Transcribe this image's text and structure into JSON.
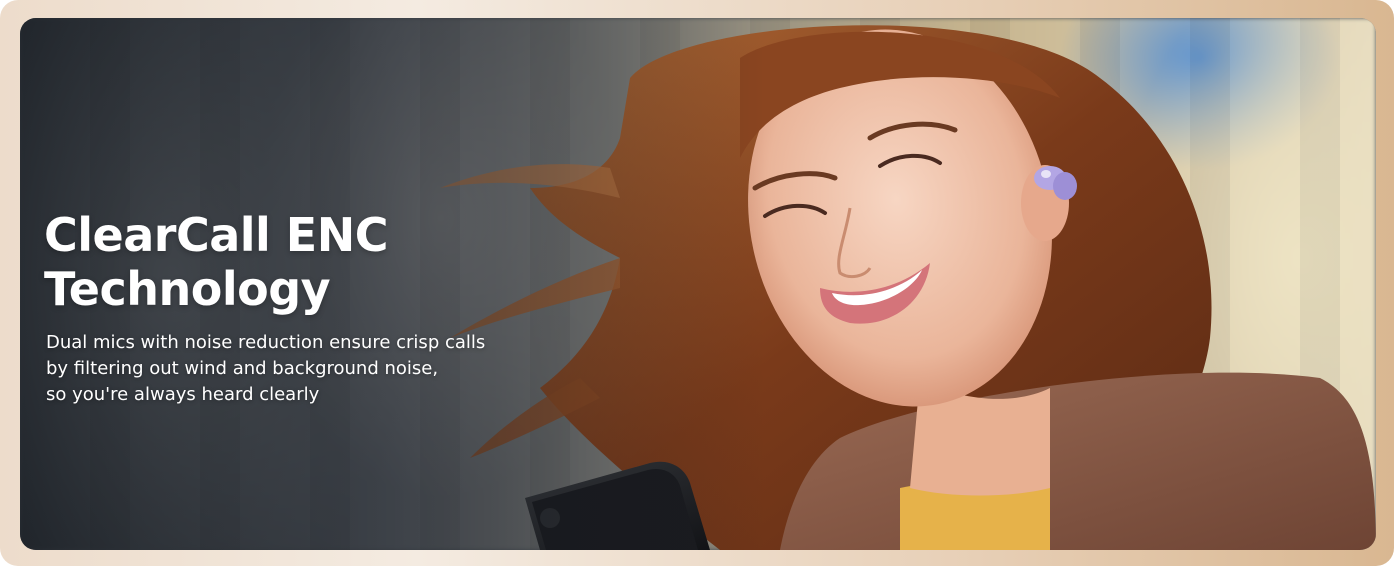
{
  "banner": {
    "headline": "ClearCall ENC\nTechnology",
    "description": "Dual mics with noise reduction ensure crisp calls\nby filtering out wind and background noise,\nso you're always heard clearly"
  },
  "colors": {
    "frame": "#e9d3bc",
    "text": "#ffffff",
    "earbud": "#a79ad8",
    "sweater": "#e6b24a",
    "hair": "#8a4a24"
  }
}
